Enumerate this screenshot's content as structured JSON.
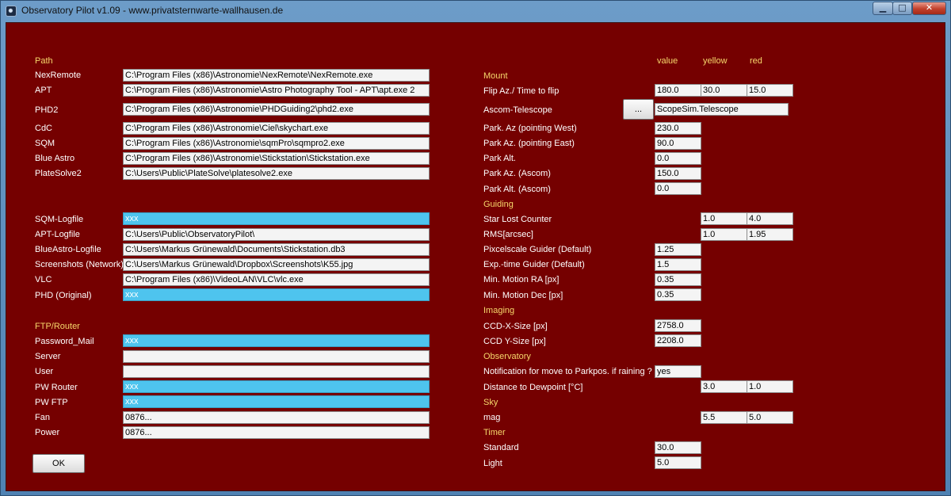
{
  "window": {
    "title": "Observatory Pilot v1.09 - www.privatsternwarte-wallhausen.de"
  },
  "colors": {
    "background": "#750000",
    "section_label": "#f6d76b",
    "highlight_field": "#4ec4ee"
  },
  "path_section": {
    "title": "Path",
    "rows": [
      {
        "label": "NexRemote",
        "value": "C:\\Program Files (x86)\\Astronomie\\NexRemote\\NexRemote.exe"
      },
      {
        "label": "APT",
        "value": "C:\\Program Files (x86)\\Astronomie\\Astro Photography Tool - APT\\apt.exe 2"
      },
      {
        "label": "PHD2",
        "value": "C:\\Program Files (x86)\\Astronomie\\PHDGuiding2\\phd2.exe"
      },
      {
        "label": "CdC",
        "value": "C:\\Program Files (x86)\\Astronomie\\Ciel\\skychart.exe"
      },
      {
        "label": "SQM",
        "value": "C:\\Program Files (x86)\\Astronomie\\sqmPro\\sqmpro2.exe"
      },
      {
        "label": "Blue Astro",
        "value": "C:\\Program Files (x86)\\Astronomie\\Stickstation\\Stickstation.exe"
      },
      {
        "label": "PlateSolve2",
        "value": "C:\\Users\\Public\\PlateSolve\\platesolve2.exe"
      }
    ]
  },
  "logfile_section": {
    "rows": [
      {
        "label": "SQM-Logfile",
        "value": "xxx"
      },
      {
        "label": "APT-Logfile",
        "value": "C:\\Users\\Public\\ObservatoryPilot\\"
      },
      {
        "label": "BlueAstro-Logfile",
        "value": "C:\\Users\\Markus Grünewald\\Documents\\Stickstation.db3"
      },
      {
        "label": "Screenshots (Network)",
        "value": "C:\\Users\\Markus Grünewald\\Dropbox\\Screenshots\\K55.jpg"
      },
      {
        "label": "VLC",
        "value": "C:\\Program Files (x86)\\VideoLAN\\VLC\\vlc.exe"
      },
      {
        "label": "PHD (Original)",
        "value": "xxx"
      }
    ]
  },
  "ftp_section": {
    "title": "FTP/Router",
    "rows": [
      {
        "label": "Password_Mail",
        "value": "xxx"
      },
      {
        "label": "Server",
        "value": ""
      },
      {
        "label": "User",
        "value": ""
      },
      {
        "label": "PW Router",
        "value": "xxx"
      },
      {
        "label": "PW FTP",
        "value": "xxx"
      },
      {
        "label": "Fan",
        "value": "0876..."
      },
      {
        "label": "Power",
        "value": "0876..."
      }
    ]
  },
  "ok_button": {
    "label": "OK"
  },
  "columns": {
    "value": "value",
    "yellow": "yellow",
    "red": "red"
  },
  "mount": {
    "title": "Mount",
    "flip": {
      "label": "Flip Az./ Time to flip",
      "value": "180.0",
      "yellow": "30.0",
      "red": "15.0"
    },
    "ascom": {
      "label": "Ascom-Telescope",
      "button": "...",
      "value": "ScopeSim.Telescope"
    },
    "park_west": {
      "label": "Park. Az (pointing West)",
      "value": "230.0"
    },
    "park_east": {
      "label": "Park Az. (pointing East)",
      "value": "90.0"
    },
    "park_alt": {
      "label": "Park Alt.",
      "value": "0.0"
    },
    "park_az_ascom": {
      "label": "Park Az. (Ascom)",
      "value": "150.0"
    },
    "park_alt_ascom": {
      "label": "Park Alt. (Ascom)",
      "value": "0.0"
    }
  },
  "guiding": {
    "title": "Guiding",
    "star_lost": {
      "label": "Star Lost Counter",
      "yellow": "1.0",
      "red": "4.0"
    },
    "rms": {
      "label": "RMS[arcsec]",
      "yellow": "1.0",
      "red": "1.95"
    },
    "pixelscale": {
      "label": "Pixcelscale Guider (Default)",
      "value": "1.25"
    },
    "exptime": {
      "label": "Exp.-time Guider (Default)",
      "value": "1.5"
    },
    "min_ra": {
      "label": "Min. Motion RA [px]",
      "value": "0.35"
    },
    "min_dec": {
      "label": "Min. Motion Dec [px]",
      "value": "0.35"
    }
  },
  "imaging": {
    "title": "Imaging",
    "ccd_x": {
      "label": "CCD-X-Size [px]",
      "value": "2758.0"
    },
    "ccd_y": {
      "label": "CCD Y-Size [px]",
      "value": "2208.0"
    }
  },
  "observatory": {
    "title": "Observatory",
    "notification": {
      "label": "Notification for move to Parkpos. if raining ?",
      "value": "yes"
    },
    "dewpoint": {
      "label": "Distance to Dewpoint [°C]",
      "yellow": "3.0",
      "red": "1.0"
    }
  },
  "sky": {
    "title": "Sky",
    "mag": {
      "label": "mag",
      "yellow": "5.5",
      "red": "5.0"
    }
  },
  "timer": {
    "title": "Timer",
    "standard": {
      "label": "Standard",
      "value": "30.0"
    },
    "light": {
      "label": "Light",
      "value": "5.0"
    }
  }
}
